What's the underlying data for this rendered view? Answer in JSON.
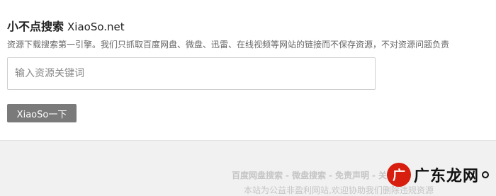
{
  "header": {
    "brand_cn": "小不点搜索",
    "brand_en": "XiaoSo.net"
  },
  "tagline": "资源下载搜索第一引擎。我们只抓取百度网盘、微盘、迅雷、在线视频等网站的链接而不保存资源，不对资源问题负责",
  "search": {
    "placeholder": "输入资源关键词",
    "value": ""
  },
  "button": {
    "label": "XiaoSo一下"
  },
  "footer": {
    "links": [
      "百度网盘搜索",
      "微盘搜索",
      "免责声明",
      "关于"
    ],
    "separator": "-",
    "note": "本站为公益非盈利网站,欢迎协助我们删除违规资源"
  },
  "watermark": {
    "logo_text": "广",
    "text": "广东龙网"
  },
  "colors": {
    "button_bg": "#7a7a7a",
    "footer_bg": "#f1f1f1",
    "footer_text": "#c5c5c5",
    "watermark_red": "#d71e0f"
  }
}
